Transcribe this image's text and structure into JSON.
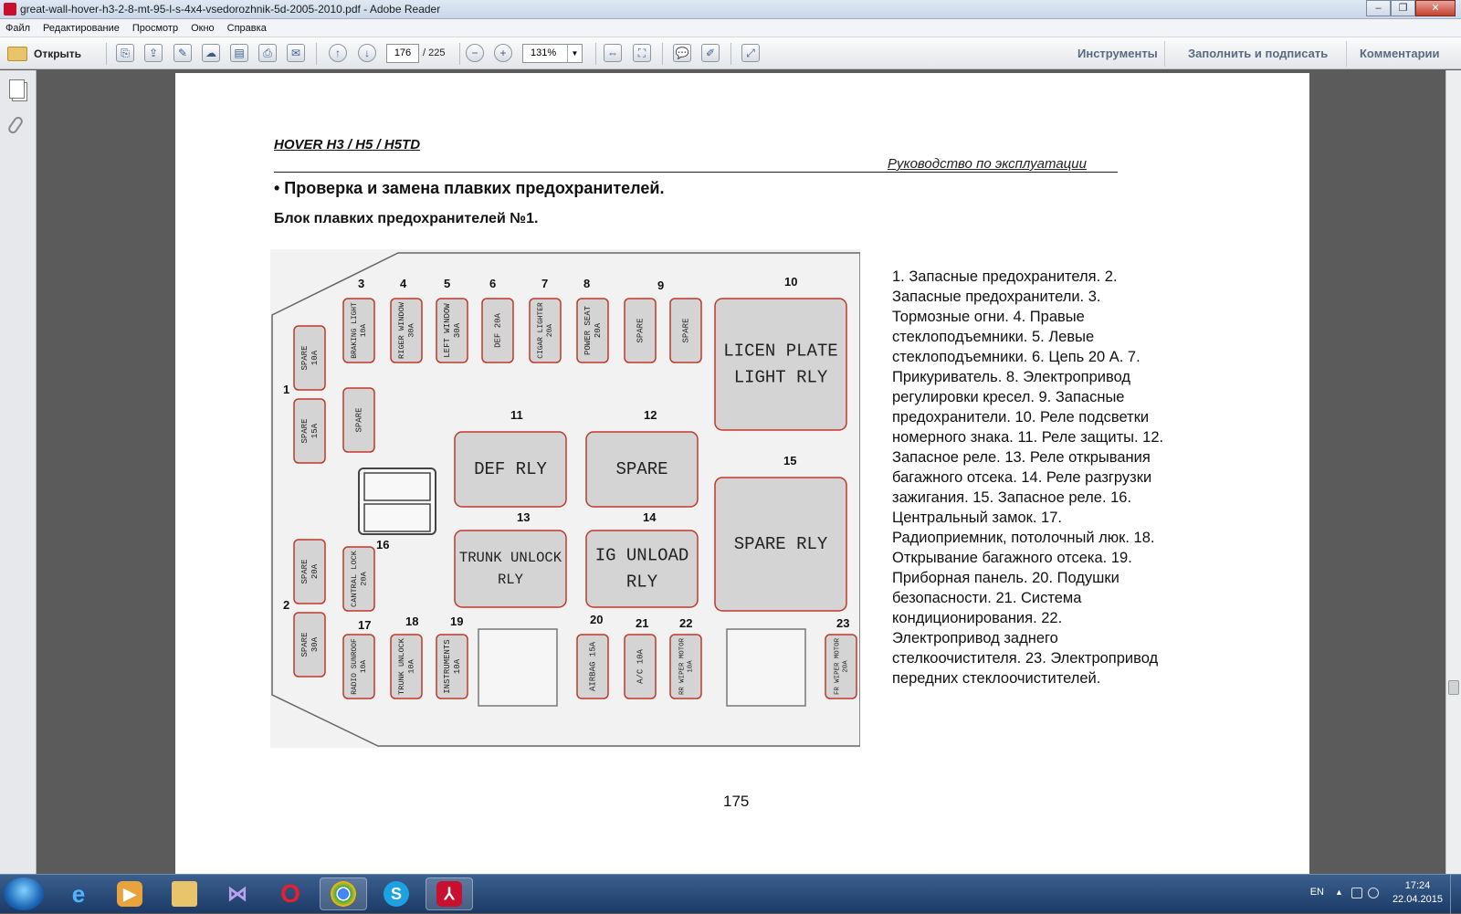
{
  "window": {
    "title": "great-wall-hover-h3-2-8-mt-95-l-s-4x4-vsedorozhnik-5d-2005-2010.pdf - Adobe Reader",
    "buttons": [
      "–",
      "❐",
      "✕"
    ]
  },
  "menu": [
    "Файл",
    "Редактирование",
    "Просмотр",
    "Окно",
    "Справка"
  ],
  "toolbar": {
    "open_label": "Открыть",
    "current_page": "176",
    "total_pages": "/ 225",
    "zoom": "131%",
    "tools": "Инструменты",
    "fill_sign": "Заполнить и подписать",
    "comments": "Комментарии"
  },
  "document": {
    "header_model": "HOVER H3 / H5 / H5TD",
    "header_manual": "Руководство по эксплуатации",
    "section_title": "• Проверка и замена плавких предохранителей.",
    "block_title": "Блок плавких предохранителей №1.",
    "legend": "1. Запасные предохранителя. 2.\nЗапасные предохранители. 3.\nТормозные огни. 4. Правые\nстеклоподъемники. 5. Левые\nстеклоподъемники. 6. Цепь 20 А. 7.\nПрикуриватель. 8. Электропривод\nрегулировки кресел. 9. Запасные\nпредохранители. 10. Реле подсветки\nномерного знака. 11. Реле защиты. 12.\nЗапасное реле. 13. Реле открывания\nбагажного отсека. 14. Реле разгрузки\nзажигания. 15. Запасное реле. 16.\nЦентральный замок. 17.\nРадиоприемник, потолочный люк. 18.\nОткрывание багажного отсека. 19.\nПриборная панель. 20. Подушки\nбезопасности. 21. Система\nкондиционирования. 22.\nЭлектропривод заднего\nстелкоочистителя. 23. Электропривод\nпередних стеклоочистителей.",
    "page_number": "175"
  },
  "fuse_diagram": {
    "numbers": [
      "1",
      "2",
      "3",
      "4",
      "5",
      "6",
      "7",
      "8",
      "9",
      "10",
      "11",
      "12",
      "13",
      "14",
      "15",
      "16",
      "17",
      "18",
      "19",
      "20",
      "21",
      "22",
      "23"
    ],
    "small_fuses": [
      {
        "lines": [
          "SPARE",
          "10A"
        ]
      },
      {
        "lines": [
          "SPARE",
          "15A"
        ]
      },
      {
        "lines": [
          "SPARE"
        ]
      },
      {
        "lines": [
          "BRAKING LIGHT",
          "10A"
        ]
      },
      {
        "lines": [
          "RIGER WINDOW",
          "30A"
        ]
      },
      {
        "lines": [
          "LEFT WINDOW",
          "30A"
        ]
      },
      {
        "lines": [
          "DEF 20A"
        ]
      },
      {
        "lines": [
          "CIGAR LIGHTER",
          "20A"
        ]
      },
      {
        "lines": [
          "POWER SEAT",
          "20A"
        ]
      },
      {
        "lines": [
          "SPARE"
        ]
      },
      {
        "lines": [
          "SPARE"
        ]
      },
      {
        "lines": [
          "SPARE",
          "20A"
        ]
      },
      {
        "lines": [
          "CANTRAL LOCK",
          "20A"
        ]
      },
      {
        "lines": [
          "SPARE",
          "30A"
        ]
      },
      {
        "lines": [
          "RADIO SUNROOF",
          "10A"
        ]
      },
      {
        "lines": [
          "TRUNK UNLOCK",
          "10A"
        ]
      },
      {
        "lines": [
          "INSTRUMENTS",
          "10A"
        ]
      },
      {
        "lines": [
          "AIRBAG 15A"
        ]
      },
      {
        "lines": [
          "A/C 10A"
        ]
      },
      {
        "lines": [
          "RR WIPER MOTOR",
          "10A"
        ]
      },
      {
        "lines": [
          "FR WIPER MOTOR",
          "20A"
        ]
      }
    ],
    "relays": [
      {
        "lines": [
          "LICEN PLATE",
          "LIGHT RLY"
        ]
      },
      {
        "lines": [
          "DEF RLY"
        ]
      },
      {
        "lines": [
          "SPARE"
        ]
      },
      {
        "lines": [
          "TRUNK UNLOCK",
          "RLY"
        ]
      },
      {
        "lines": [
          "IG UNLOAD",
          "RLY"
        ]
      },
      {
        "lines": [
          "SPARE RLY"
        ]
      }
    ]
  },
  "taskbar": {
    "language": "EN",
    "time": "17:24",
    "date": "22.04.2015"
  },
  "colors": {
    "fuse_fill": "#d4d4d4",
    "fuse_border": "#c0392b",
    "panel_fill": "#f2f2f2",
    "accent_pdf": "#c8102e"
  }
}
